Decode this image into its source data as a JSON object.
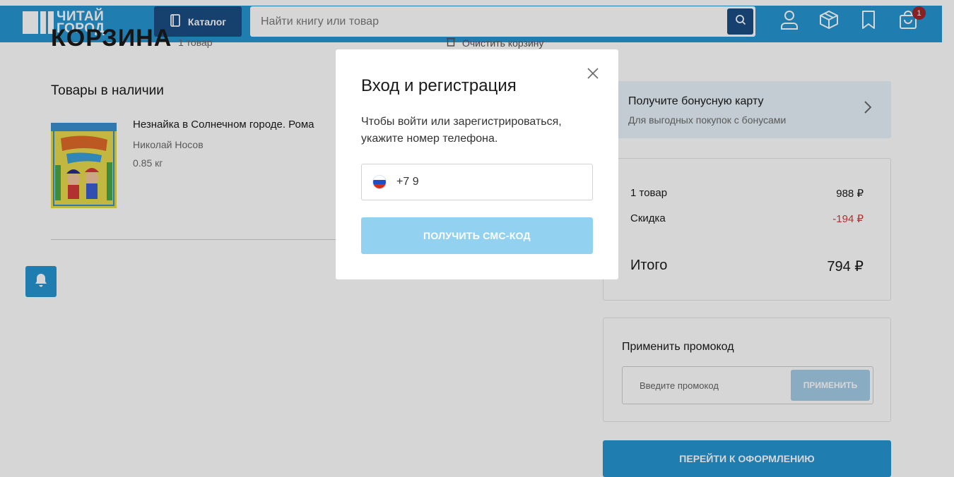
{
  "header": {
    "logo_line1": "ЧИТАЙ",
    "logo_line2": "ГОРОД",
    "catalog_label": "Каталог",
    "search_placeholder": "Найти книгу или товар",
    "cart_count": "1",
    "colors": {
      "header_bg": "#2596d1",
      "dark_button": "#1b4d82",
      "badge": "#a2272d"
    },
    "icons": [
      "search-icon",
      "user-icon",
      "box-icon",
      "bookmark-icon",
      "cart-icon"
    ]
  },
  "page": {
    "title": "КОРЗИНА",
    "count": "1 товар",
    "clear_label": "Очистить корзину",
    "section_title": "Товары в наличии"
  },
  "product": {
    "name": "Незнайка в Солнечном городе. Рома",
    "author": "Николай Носов",
    "weight": "0.85 кг"
  },
  "bonus": {
    "title": "Получите бонусную карту",
    "subtitle": "Для выгодных покупок с бонусами"
  },
  "summary": {
    "items_label": "1 товар",
    "items_price": "988 ₽",
    "discount_label": "Скидка",
    "discount_value": "-194 ₽",
    "total_label": "Итого",
    "total_value": "794 ₽"
  },
  "promo": {
    "title": "Применить промокод",
    "placeholder": "Введите промокод",
    "apply_label": "ПРИМЕНИТЬ"
  },
  "checkout_label": "ПЕРЕЙТИ К ОФОРМЛЕНИЮ",
  "modal": {
    "title": "Вход и регистрация",
    "description": "Чтобы войти или зарегистрироваться, укажите номер телефона.",
    "phone_value": "+7 9",
    "submit_label": "ПОЛУЧИТЬ СМС-КОД"
  }
}
